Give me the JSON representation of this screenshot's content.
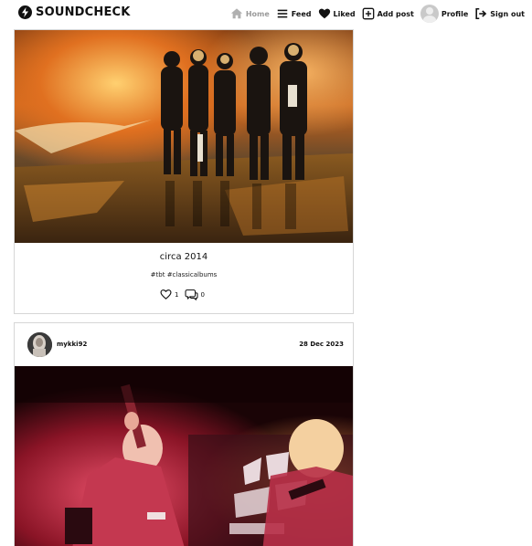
{
  "brand": {
    "name": "SOUNDCHECK",
    "icon": "lightning-bolt-icon"
  },
  "nav": {
    "items": [
      {
        "label": "Home",
        "icon": "home-icon",
        "active": true
      },
      {
        "label": "Feed",
        "icon": "feed-icon"
      },
      {
        "label": "Liked",
        "icon": "heart-icon"
      },
      {
        "label": "Add post",
        "icon": "add-post-icon"
      },
      {
        "label": "Profile",
        "icon": "avatar"
      },
      {
        "label": "Sign out",
        "icon": "sign-out-icon"
      }
    ]
  },
  "posts": [
    {
      "caption": "circa 2014",
      "tags": "#tbt #classicalbums",
      "likes": "1",
      "comments": "0"
    },
    {
      "username": "mykki92",
      "date": "28 Dec 2023"
    }
  ],
  "colors": {
    "muted_nav": "#9a9a9a",
    "border": "#d6d6d6",
    "text": "#111111"
  }
}
